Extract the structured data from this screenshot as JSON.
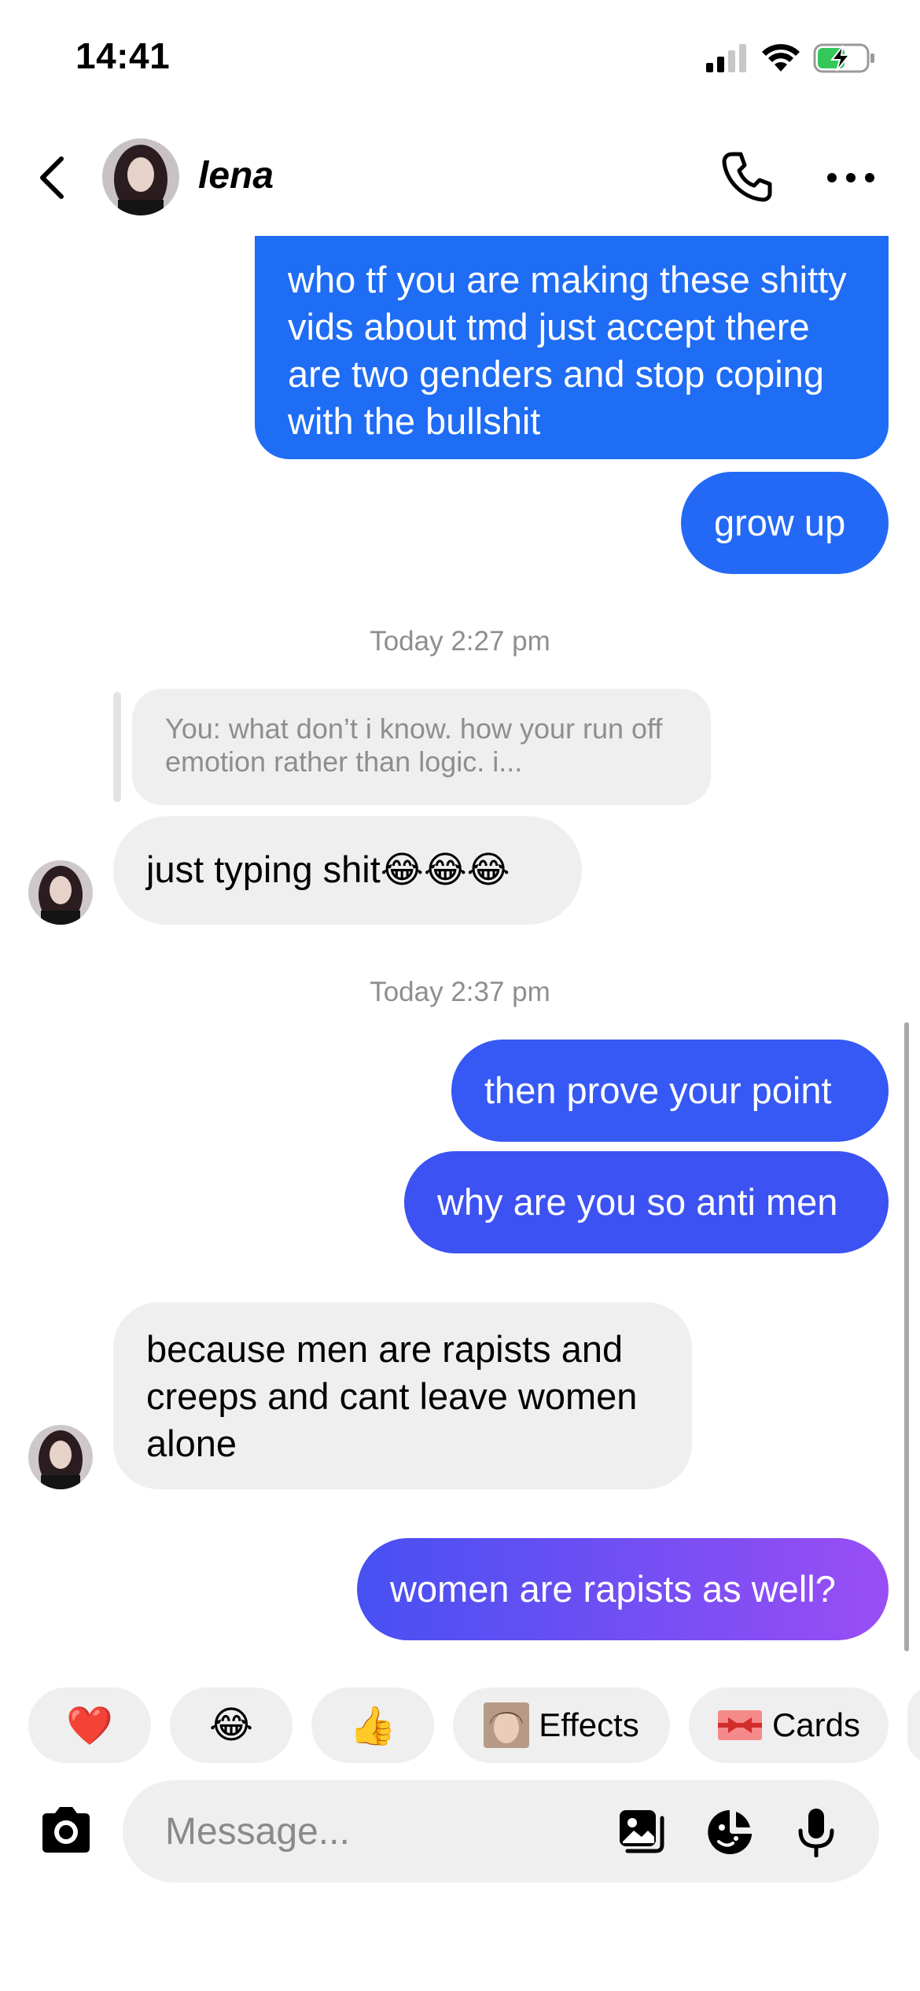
{
  "status_bar": {
    "time": "14:41"
  },
  "header": {
    "contact_name": "lena"
  },
  "messages": {
    "m1_partial": "who tf you are making these shitty vids about tmd just accept there are two genders and stop coping with the bullshit",
    "m2": "grow up",
    "stamp1": "Today 2:27 pm",
    "reply_quote": "You: what don’t i know. how your run off emotion rather than logic. i...",
    "m3": "just typing shit😂😂😂",
    "stamp2": "Today 2:37 pm",
    "m4": "then prove your point",
    "m5": "why are you so anti men",
    "m6": "because men are rapists and creeps and cant leave women alone",
    "m7": "women are rapists as well?"
  },
  "quick_reactions": {
    "heart": "❤️",
    "laugh": "😂",
    "thumbs": "👍",
    "effects_label": "Effects",
    "cards_label": "Cards"
  },
  "composer": {
    "placeholder": "Message..."
  },
  "colors": {
    "outgoing_top": "#1d6ef5",
    "outgoing_mid": "#3a4ef3",
    "outgoing_bottom_end": "#9b4cf5",
    "incoming": "#efefef"
  }
}
